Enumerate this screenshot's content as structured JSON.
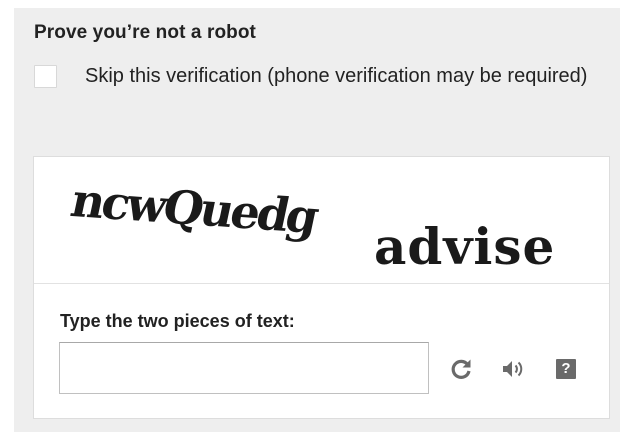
{
  "verification": {
    "heading": "Prove you’re not a robot",
    "skip_label": "Skip this verification (phone verification may be required)",
    "skip_checked": false
  },
  "captcha": {
    "words": [
      "ncwQuedg",
      "advise"
    ],
    "prompt": "Type the two pieces of text:",
    "answer_value": "",
    "answer_placeholder": "",
    "controls": [
      {
        "name": "reload",
        "icon": "reload-icon"
      },
      {
        "name": "audio",
        "icon": "speaker-icon"
      },
      {
        "name": "help",
        "icon": "help-icon",
        "glyph": "?"
      }
    ]
  },
  "colors": {
    "panel_background": "#eeeeee",
    "captcha_background": "#ffffff",
    "icon_color": "#6a6a6a",
    "text_color": "#222222"
  }
}
